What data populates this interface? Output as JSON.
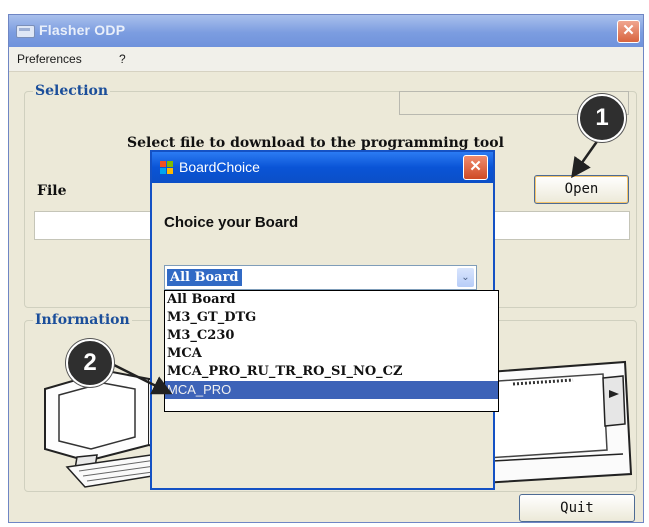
{
  "window": {
    "title": "Flasher ODP",
    "close_glyph": "✕"
  },
  "menu": {
    "items": [
      "Preferences",
      "?"
    ]
  },
  "selection": {
    "group_title": "Selection",
    "instruction": "Select file to download to the programming tool",
    "file_label": "File",
    "file_value": "",
    "open_label": "Open"
  },
  "information": {
    "group_title": "Information"
  },
  "quit_label": "Quit",
  "dialog": {
    "title": "BoardChoice",
    "close_glyph": "✕",
    "heading": "Choice your Board",
    "combo_value": "All Board",
    "combo_arrow_glyph": "⌄",
    "options": [
      "All Board",
      "M3_GT_DTG",
      "M3_C230",
      "MCA",
      "MCA_PRO_RU_TR_RO_SI_NO_CZ",
      "MCA_PRO"
    ],
    "selected_option": "MCA_PRO"
  },
  "callouts": {
    "one": "1",
    "two": "2"
  },
  "icons": {
    "app": "window-app-icon",
    "dialog": "windows-flag-icon"
  },
  "colors": {
    "title_bar": "#7c9de0",
    "dialog_title_bar": "#0a54d6",
    "group_title": "#1b4e9a",
    "selection_highlight": "#316ac5",
    "close_button": "#d8643f"
  }
}
